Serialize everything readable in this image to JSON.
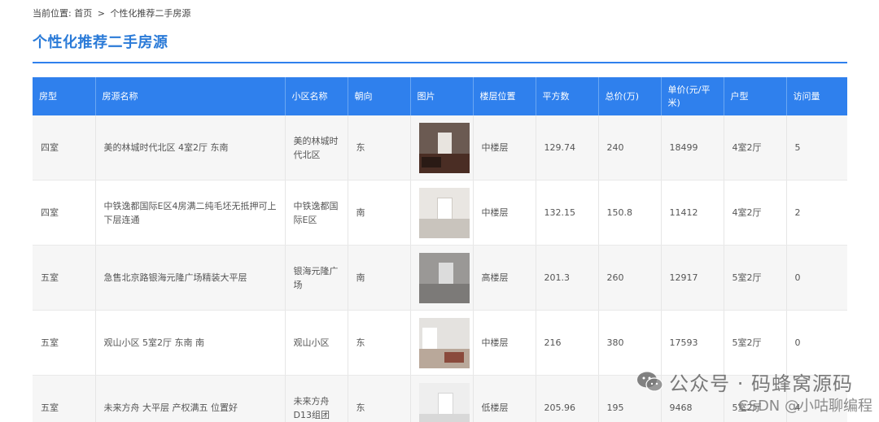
{
  "breadcrumb": {
    "prefix": "当前位置:",
    "home": "首页",
    "separator": ">",
    "current": "个性化推荐二手房源"
  },
  "page_title": "个性化推荐二手房源",
  "table": {
    "headers": [
      "房型",
      "房源名称",
      "小区名称",
      "朝向",
      "图片",
      "楼层位置",
      "平方数",
      "总价(万)",
      "单价(元/平米)",
      "户型",
      "访问量"
    ],
    "rows": [
      {
        "type": "四室",
        "name": "美的林城时代北区 4室2厅 东南",
        "community": "美的林城时代北区",
        "orientation": "东",
        "image": "photo-dark-living-room",
        "floor": "中楼层",
        "area": "129.74",
        "total": "240",
        "unit_price": "18499",
        "layout": "4室2厅",
        "views": "5"
      },
      {
        "type": "四室",
        "name": "中铁逸都国际E区4房满二纯毛坯无抵押可上下层连通",
        "community": "中铁逸都国际E区",
        "orientation": "南",
        "image": "photo-empty-room",
        "floor": "中楼层",
        "area": "132.15",
        "total": "150.8",
        "unit_price": "11412",
        "layout": "4室2厅",
        "views": "2"
      },
      {
        "type": "五室",
        "name": "急售北京路银海元隆广场精装大平层",
        "community": "银海元隆广场",
        "orientation": "南",
        "image": "photo-grey-hall",
        "floor": "高楼层",
        "area": "201.3",
        "total": "260",
        "unit_price": "12917",
        "layout": "5室2厅",
        "views": "0"
      },
      {
        "type": "五室",
        "name": "观山小区 5室2厅 东南 南",
        "community": "观山小区",
        "orientation": "东",
        "image": "photo-bright-room",
        "floor": "中楼层",
        "area": "216",
        "total": "380",
        "unit_price": "17593",
        "layout": "5室2厅",
        "views": "0"
      },
      {
        "type": "五室",
        "name": "未来方舟 大平层 产权满五 位置好",
        "community": "未来方舟D13组团",
        "orientation": "东",
        "image": "photo-white-room",
        "floor": "低楼层",
        "area": "205.96",
        "total": "195",
        "unit_price": "9468",
        "layout": "5室2厅",
        "views": "4"
      }
    ]
  },
  "watermark": {
    "text": "公众号 · 码蜂窝源码",
    "icon": "wechat-icon"
  },
  "csdn_watermark": "CSDN @小咕聊编程",
  "colors": {
    "accent": "#2f80ed",
    "title": "#2b7bd8"
  }
}
